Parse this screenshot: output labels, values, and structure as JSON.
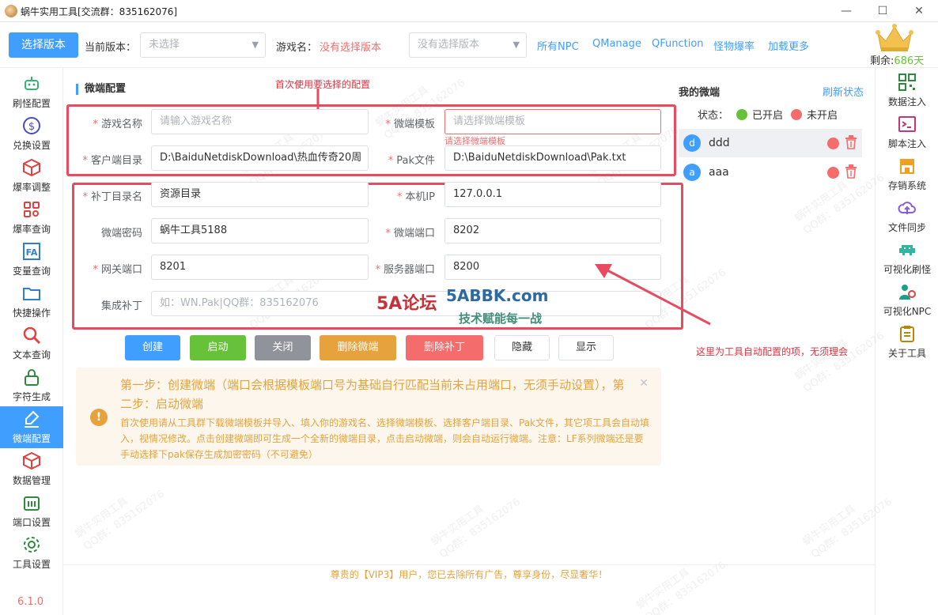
{
  "window": {
    "title": "蜗牛实用工具[交流群：835162076]"
  },
  "toolbar": {
    "select_version_button": "选择版本",
    "current_version_label": "当前版本：",
    "current_version_placeholder": "未选择",
    "game_name_label": "游戏名：",
    "game_name_value": "没有选择版本",
    "version_select_placeholder": "没有选择版本",
    "links": [
      "所有NPC",
      "QManage",
      "QFunction",
      "怪物爆率",
      "加载更多"
    ],
    "remain_label": "剩余:",
    "remain_value": "686天"
  },
  "left_nav": {
    "items": [
      {
        "label": "刷怪配置",
        "icon": "robot-icon"
      },
      {
        "label": "兑换设置",
        "icon": "dollar-icon"
      },
      {
        "label": "爆率调整",
        "icon": "box-icon"
      },
      {
        "label": "爆率查询",
        "icon": "grid-search-icon"
      },
      {
        "label": "变量查询",
        "icon": "variable-icon"
      },
      {
        "label": "快捷操作",
        "icon": "folder-icon"
      },
      {
        "label": "文本查询",
        "icon": "search-icon"
      },
      {
        "label": "字符生成",
        "icon": "lock-icon"
      },
      {
        "label": "微端配置",
        "icon": "brush-icon"
      },
      {
        "label": "数据管理",
        "icon": "cube-icon"
      },
      {
        "label": "端口设置",
        "icon": "port-icon"
      },
      {
        "label": "工具设置",
        "icon": "gear-icon"
      }
    ],
    "version": "6.1.0"
  },
  "right_nav": {
    "items": [
      {
        "label": "数据注入",
        "icon": "qrcode-icon"
      },
      {
        "label": "脚本注入",
        "icon": "terminal-icon"
      },
      {
        "label": "存销系统",
        "icon": "store-icon"
      },
      {
        "label": "文件同步",
        "icon": "cloud-sync-icon"
      },
      {
        "label": "可视化刷怪",
        "icon": "invader-icon"
      },
      {
        "label": "可视化NPC",
        "icon": "npc-icon"
      },
      {
        "label": "关于工具",
        "icon": "clipboard-icon"
      }
    ]
  },
  "main": {
    "section_title": "微端配置",
    "annotation_top": "首次使用要选择的配置",
    "annotation_right": "这里为工具自动配置的项，无须理会",
    "fields": {
      "game_name": {
        "label": "游戏名称",
        "placeholder": "请输入游戏名称"
      },
      "template": {
        "label": "微端模板",
        "placeholder": "请选择微端模板",
        "error": "请选择微端模板"
      },
      "client_dir": {
        "label": "客户端目录",
        "value": "D:\\BaiduNetdiskDownload\\热血传奇20周"
      },
      "pak_file": {
        "label": "Pak文件",
        "value": "D:\\BaiduNetdiskDownload\\Pak.txt"
      },
      "patch_dir": {
        "label": "补丁目录名",
        "value": "资源目录"
      },
      "local_ip": {
        "label": "本机IP",
        "value": "127.0.0.1"
      },
      "password": {
        "label": "微端密码",
        "value": "蜗牛工具5188"
      },
      "port": {
        "label": "微端端口",
        "value": "8202"
      },
      "gateway_port": {
        "label": "网关端口",
        "value": "8201"
      },
      "server_port": {
        "label": "服务器端口",
        "value": "8200"
      },
      "integrate_patch": {
        "label": "集成补丁",
        "placeholder": "如：WN.Pak|QQ群：835162076"
      }
    },
    "buttons": {
      "create": "创建",
      "start": "启动",
      "close": "关闭",
      "delete_client": "删除微端",
      "delete_patch": "删除补丁",
      "hide": "隐藏",
      "show": "显示"
    },
    "alert": {
      "title": "第一步：创建微端（端口会根据模板端口号为基础自行匹配当前未占用端口，无须手动设置），第二步：启动微端",
      "description": "首次使用请从工具群下载微端模板并导入、填入你的游戏名、选择微端模板、选择客户端目录、Pak文件，其它项工具会自动填入，视情况修改。点击创建微端即可生成一个全新的微端目录，点击启动微端，则会自动运行微端。注意：LF系列微端还是要手动选择下pak保存生成加密密码（不可避免）"
    }
  },
  "my_clients": {
    "title": "我的微端",
    "refresh": "刷新状态",
    "status_label": "状态：",
    "status_on": "已开启",
    "status_off": "未开启",
    "items": [
      {
        "avatar": "d",
        "name": "ddd"
      },
      {
        "avatar": "a",
        "name": "aaa"
      }
    ]
  },
  "watermark": {
    "line1": "蜗牛实用工具",
    "line2": "QQ群：835162076",
    "logo_text_1": "5A论坛",
    "logo_text_2": "5ABBK.com",
    "logo_text_3": "技术赋能每一战"
  },
  "footer": {
    "message": "尊贵的【VIP3】用户，您已去除所有广告，尊享身份，尽显奢华！"
  },
  "colors": {
    "primary": "#409eff",
    "success": "#67c23a",
    "info": "#909399",
    "warning": "#e6a23c",
    "danger": "#f56c6c",
    "annotation": "#e84a5f"
  }
}
